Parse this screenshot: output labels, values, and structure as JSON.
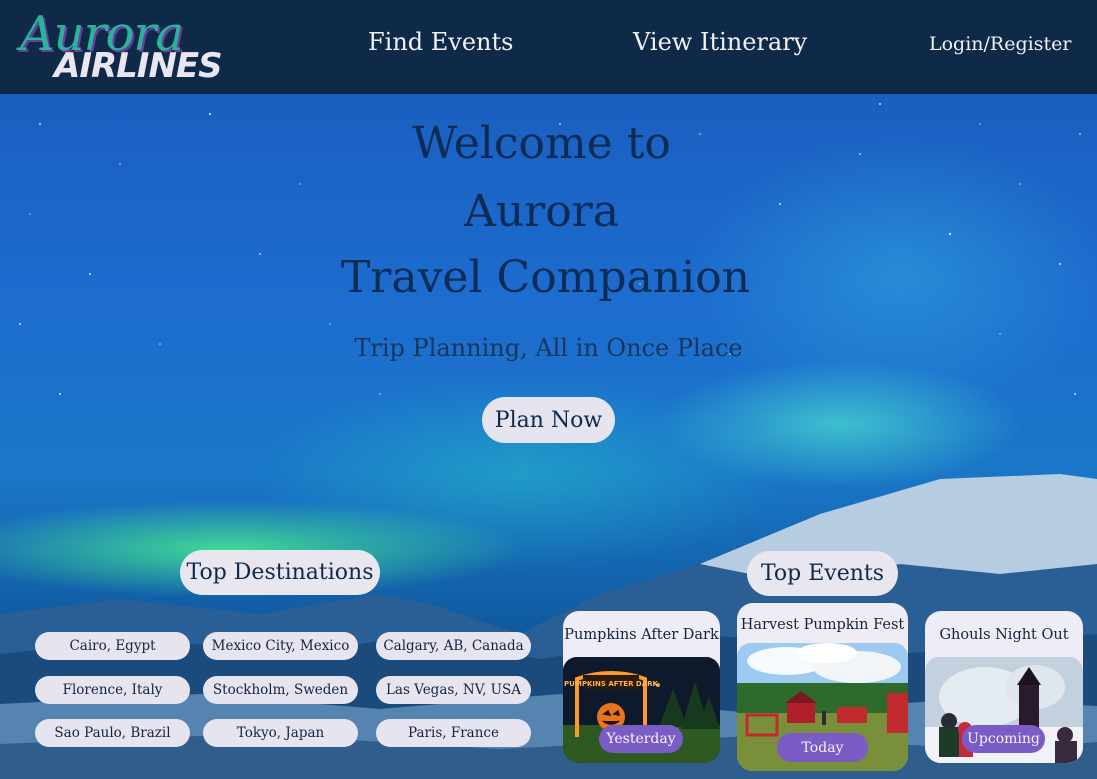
{
  "header": {
    "logo_script": "Aurora",
    "logo_block": "AIRLINES",
    "nav": {
      "find_events": "Find Events",
      "view_itinerary": "View Itinerary",
      "login": "Login/Register"
    }
  },
  "hero": {
    "title_line1": "Welcome to",
    "title_line2": "Aurora",
    "title_line3": "Travel Companion",
    "subtitle": "Trip Planning, All in Once Place",
    "cta": "Plan Now"
  },
  "destinations": {
    "heading": "Top Destinations",
    "items": [
      "Cairo, Egypt",
      "Mexico City, Mexico",
      "Calgary, AB, Canada",
      "Florence, Italy",
      "Stockholm, Sweden",
      "Las Vegas, NV, USA",
      "Sao Paulo, Brazil",
      "Tokyo, Japan",
      "Paris, France"
    ]
  },
  "events": {
    "heading": "Top Events",
    "items": [
      {
        "title": "Pumpkins After Dark",
        "badge": "Yesterday",
        "sign": "PUMPKINS AFTER DARK"
      },
      {
        "title": "Harvest Pumpkin Fest",
        "badge": "Today"
      },
      {
        "title": "Ghouls Night Out",
        "badge": "Upcoming"
      }
    ]
  },
  "colors": {
    "header_bg": "#0e2a48",
    "pill_bg": "#e6e4ee",
    "badge_bg": "#7a5cc4",
    "title_text": "#0c2b55"
  }
}
